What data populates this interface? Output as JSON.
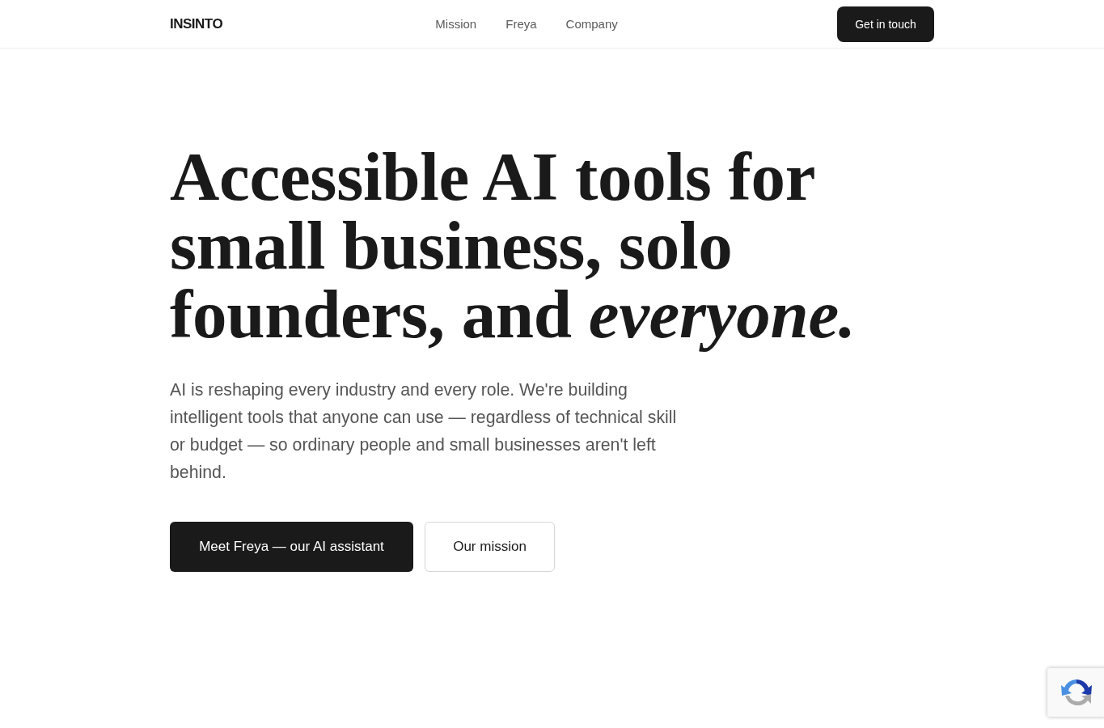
{
  "header": {
    "logo": "INSINTO",
    "nav": [
      "Mission",
      "Freya",
      "Company"
    ],
    "cta": "Get in touch"
  },
  "hero": {
    "headline": "Accessible AI tools for small business, solo founders, and *everyone.*",
    "description": "AI is reshaping every industry and every role. We're building intelligent tools that anyone can use — regardless of technical skill or budget — so ordinary people and small businesses aren't left behind.",
    "buttons": [
      {
        "label": "Meet Freya — our AI assistant",
        "kind": "primary"
      },
      {
        "label": "Our mission",
        "kind": "secondary"
      }
    ]
  }
}
